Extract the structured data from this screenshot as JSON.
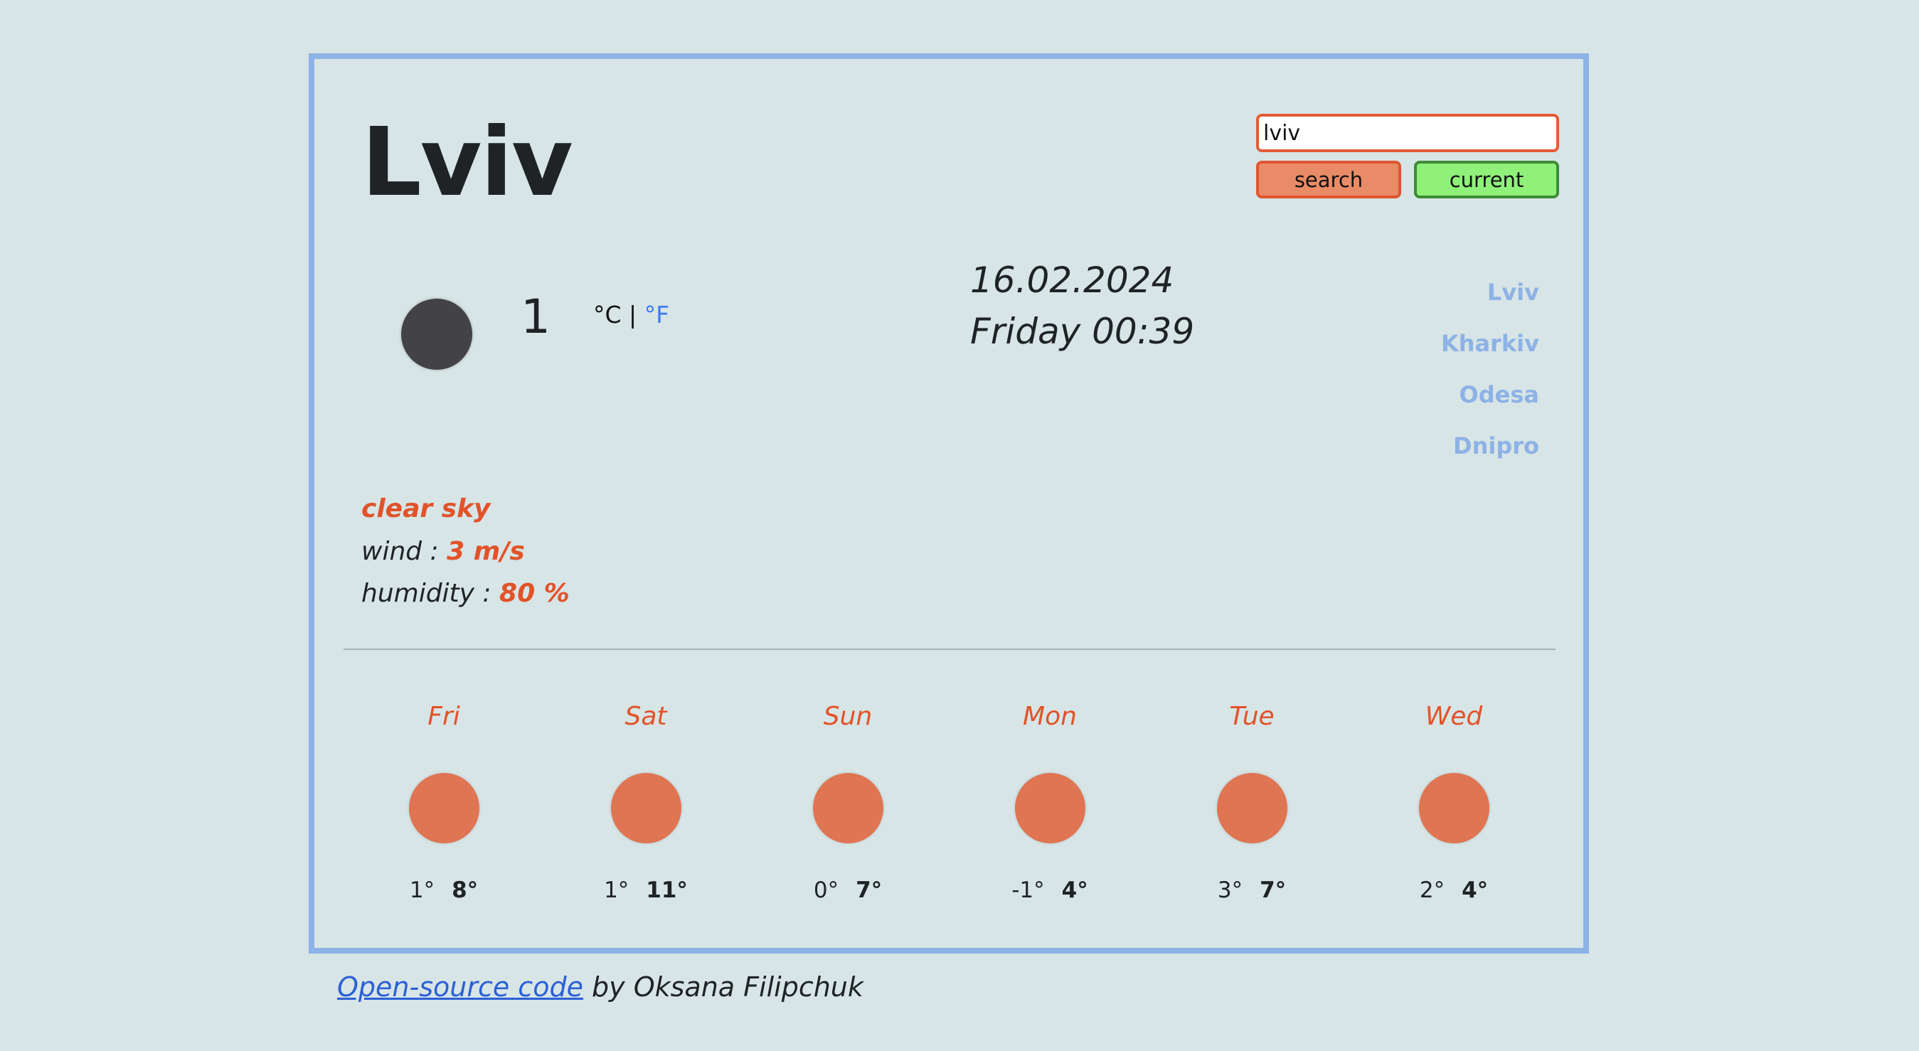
{
  "city": "Lviv",
  "search": {
    "value": "lviv",
    "search_label": "search",
    "current_label": "current"
  },
  "current": {
    "temperature": "1",
    "unit_c": "°C",
    "separator": "|",
    "unit_f": "°F",
    "date": "16.02.2024",
    "day_time": "Friday 00:39",
    "icon": "moon-icon",
    "description": "clear sky",
    "wind_label": "wind :",
    "wind_value": "3 m/s",
    "humidity_label": "humidity :",
    "humidity_value": "80 %"
  },
  "cities": [
    "Lviv",
    "Kharkiv",
    "Odesa",
    "Dnipro"
  ],
  "forecast": [
    {
      "day": "Fri",
      "min": "1°",
      "max": "8°"
    },
    {
      "day": "Sat",
      "min": "1°",
      "max": "11°"
    },
    {
      "day": "Sun",
      "min": "0°",
      "max": "7°"
    },
    {
      "day": "Mon",
      "min": "-1°",
      "max": "4°"
    },
    {
      "day": "Tue",
      "min": "3°",
      "max": "7°"
    },
    {
      "day": "Wed",
      "min": "2°",
      "max": "4°"
    }
  ],
  "footer": {
    "link_text": "Open-source code",
    "suffix": " by Oksana Filipchuk"
  },
  "colors": {
    "accent": "#e25329",
    "border": "#8db2e6",
    "background": "#d8e5e6",
    "search_button": "#e98b66",
    "current_button": "#8ff07a"
  }
}
